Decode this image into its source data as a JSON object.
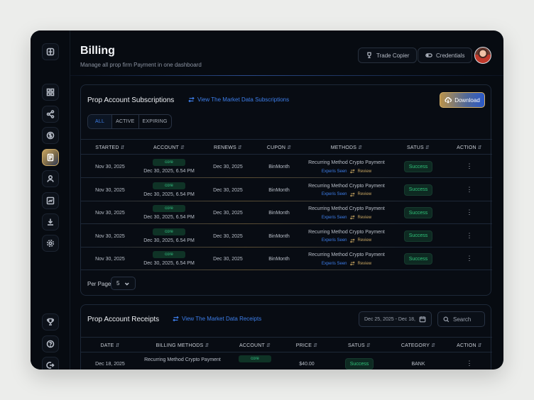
{
  "header": {
    "title": "Billing",
    "subtitle": "Manage all prop firm Payment in one dashboard",
    "trade_copier_label": "Trade Copier",
    "credentials_label": "Credentials"
  },
  "sidebar": {
    "items": [
      {
        "icon": "grid-icon"
      },
      {
        "icon": "share-icon"
      },
      {
        "icon": "dollar-icon"
      },
      {
        "icon": "billing-icon",
        "active": true
      },
      {
        "icon": "user-icon"
      },
      {
        "icon": "chart-icon"
      },
      {
        "icon": "download-icon"
      },
      {
        "icon": "settings-icon"
      }
    ],
    "bottom": [
      {
        "icon": "trophy-icon"
      },
      {
        "icon": "help-icon"
      },
      {
        "icon": "logout-icon"
      }
    ]
  },
  "subscriptions": {
    "title": "Prop Account Subscriptions",
    "link": "View The Market Data Subscriptions",
    "download_label": "Download",
    "filters": [
      "ALL",
      "ACTIVE",
      "EXPIRING"
    ],
    "columns": [
      "STARTED",
      "ACCOUNT",
      "RENEWS",
      "CUPON",
      "METHODS",
      "SATUS",
      "ACTION"
    ],
    "rows": [
      {
        "started": "Nov 30, 2025",
        "badge": "core",
        "account_date": "Dec 30, 2025, 6.54 PM",
        "renews": "Dec 30, 2025",
        "cupon": "BinMonth",
        "method": "Recurring Method Crypto Payment",
        "method_link": "Experis Seen",
        "review": "Review",
        "status": "Success",
        "action": "⋮"
      },
      {
        "started": "Nov 30, 2025",
        "badge": "core",
        "account_date": "Dec 30, 2025, 6.54 PM",
        "renews": "Dec 30, 2025",
        "cupon": "BinMonth",
        "method": "Recurring Method Crypto Payment",
        "method_link": "Experis Seen",
        "review": "Review",
        "status": "Success",
        "action": "⋮"
      },
      {
        "started": "Nov 30, 2025",
        "badge": "core",
        "account_date": "Dec 30, 2025, 6.54 PM",
        "renews": "Dec 30, 2025",
        "cupon": "BinMonth",
        "method": "Recurring Method Crypto Payment",
        "method_link": "Experis Seen",
        "review": "Review",
        "status": "Success",
        "action": "⋮"
      },
      {
        "started": "Nov 30, 2025",
        "badge": "core",
        "account_date": "Dec 30, 2025, 6.54 PM",
        "renews": "Dec 30, 2025",
        "cupon": "BinMonth",
        "method": "Recurring Method Crypto Payment",
        "method_link": "Experis Seen",
        "review": "Review",
        "status": "Success",
        "action": "⋮"
      },
      {
        "started": "Nov 30, 2025",
        "badge": "core",
        "account_date": "Dec 30, 2025, 6.54 PM",
        "renews": "Dec 30, 2025",
        "cupon": "BinMonth",
        "method": "Recurring Method Crypto Payment",
        "method_link": "Experis Seen",
        "review": "Review",
        "status": "Success",
        "action": "⋮"
      }
    ],
    "per_page_label": "Per Page",
    "per_page_value": "5"
  },
  "receipts": {
    "title": "Prop Account Receipts",
    "link": "View The Market Data Receipts",
    "date_range": "Dec 25, 2025 - Dec 18,",
    "search_placeholder": "Search",
    "columns": [
      "DATE",
      "BILLING METHODS",
      "ACCOUNT",
      "PRICE",
      "SATUS",
      "CATEGORY",
      "ACTION"
    ],
    "rows": [
      {
        "date": "Dec 18, 2025",
        "method": "Recurring Method Crypto Payment",
        "badge": "core",
        "price": "$40.00",
        "status": "Success",
        "category": "BANK",
        "action": "⋮"
      }
    ]
  },
  "colors": {
    "accent_blue": "#3d7eea",
    "accent_gold": "#c9a662",
    "success_green": "#2fc47a",
    "background": "#070b11"
  }
}
